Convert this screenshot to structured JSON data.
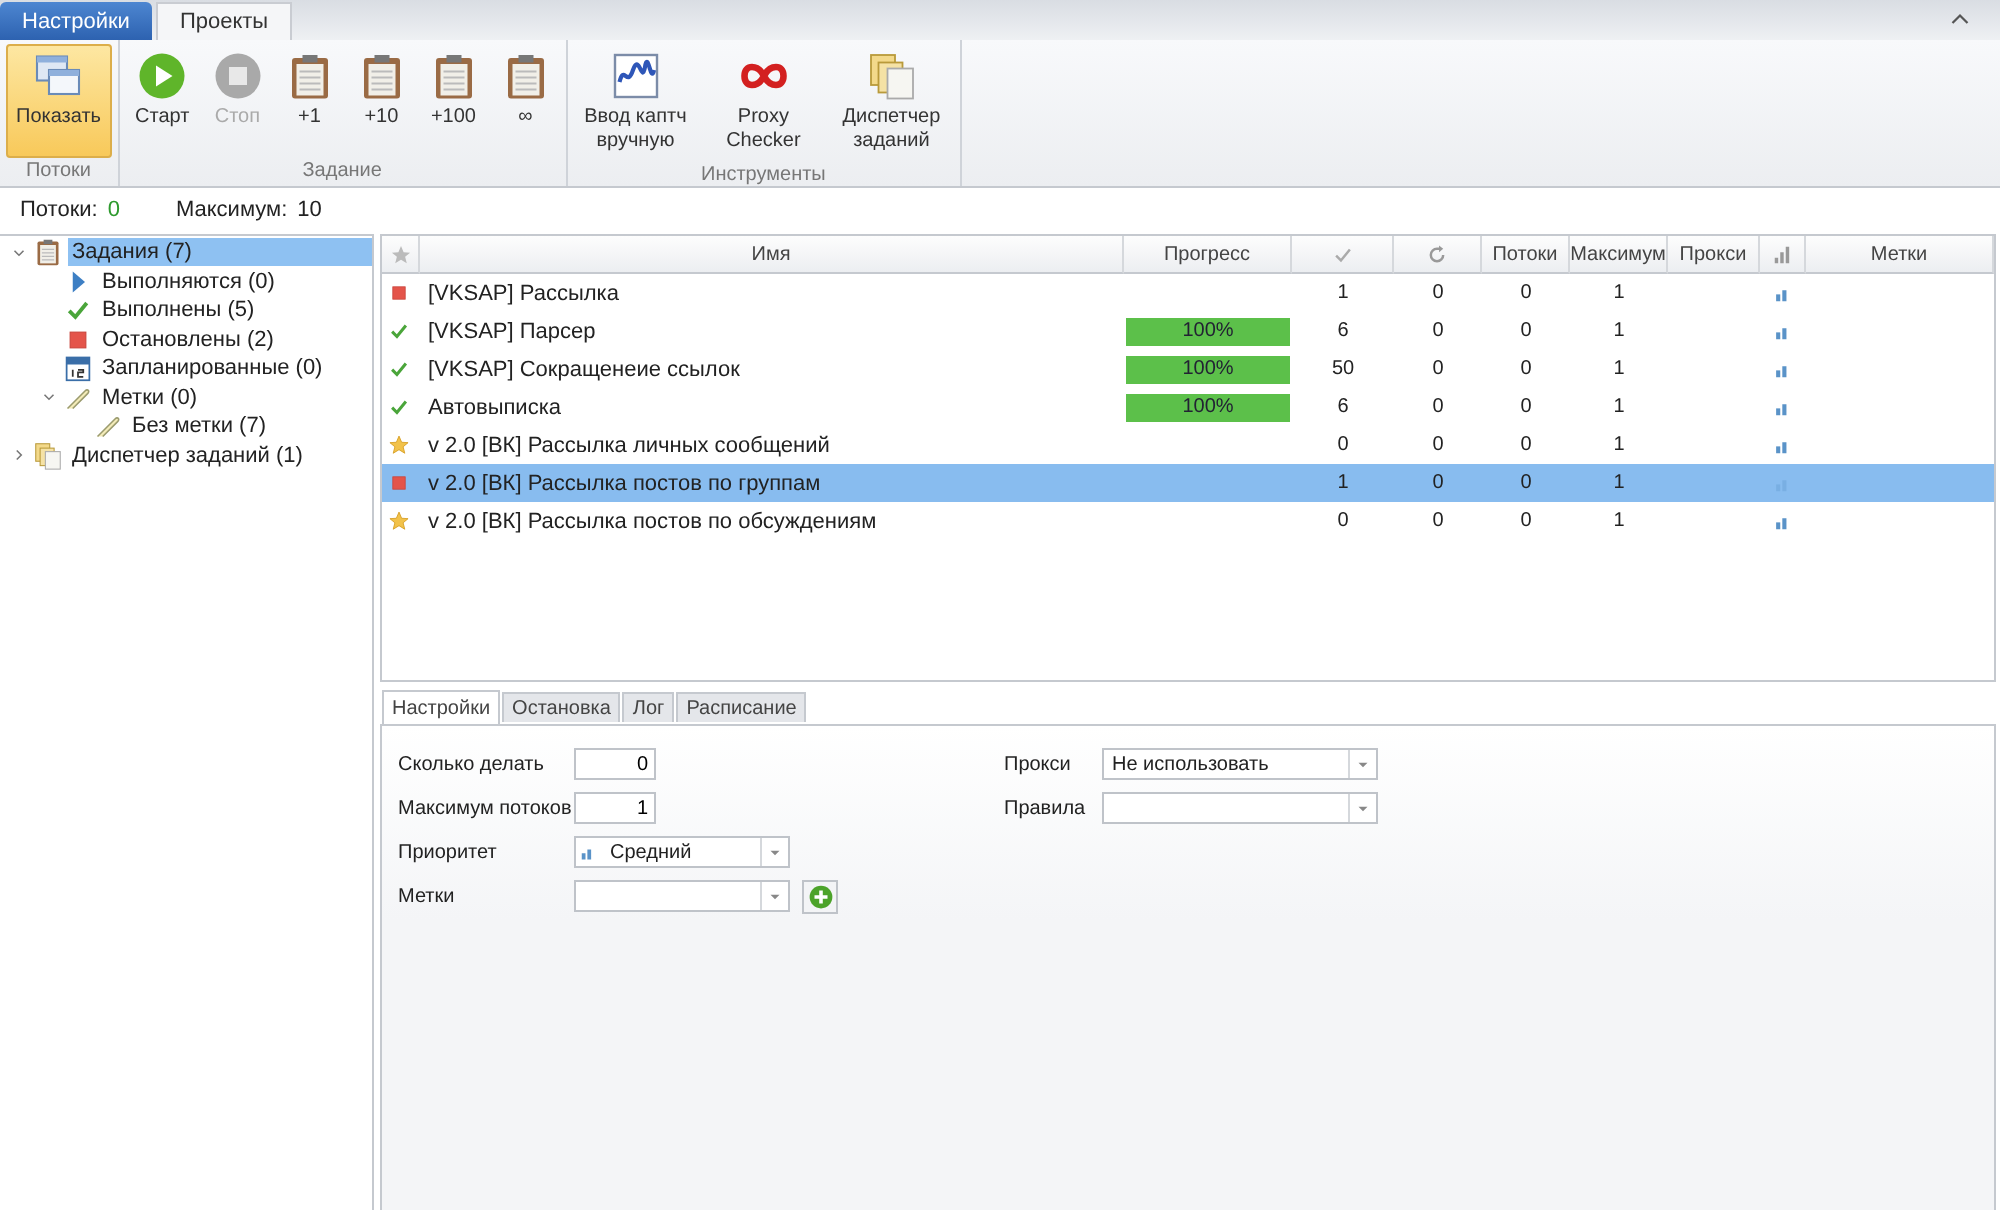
{
  "tabs": [
    {
      "label": "Настройки",
      "kind": "app",
      "selected": false
    },
    {
      "label": "Проекты",
      "kind": "tab",
      "selected": true
    }
  ],
  "ribbon_groups": [
    {
      "label": "Потоки",
      "buttons": [
        {
          "label": "Показать",
          "kind": "windows",
          "pressed": true,
          "disabled": false
        }
      ]
    },
    {
      "label": "Задание",
      "buttons": [
        {
          "label": "Старт",
          "kind": "play",
          "pressed": false,
          "disabled": false
        },
        {
          "label": "Стоп",
          "kind": "stop",
          "pressed": false,
          "disabled": true
        },
        {
          "label": "+1",
          "kind": "clipboard",
          "pressed": false,
          "disabled": false
        },
        {
          "label": "+10",
          "kind": "clipboard",
          "pressed": false,
          "disabled": false
        },
        {
          "label": "+100",
          "kind": "clipboard",
          "pressed": false,
          "disabled": false
        },
        {
          "label": "∞",
          "kind": "clipboard",
          "pressed": false,
          "disabled": false
        }
      ]
    },
    {
      "label": "Инструменты",
      "buttons": [
        {
          "label": "Ввод каптч вручную",
          "kind": "captcha",
          "pressed": false,
          "disabled": false
        },
        {
          "label": "Proxy Checker",
          "kind": "infinity",
          "pressed": false,
          "disabled": false
        },
        {
          "label": "Диспетчер заданий",
          "kind": "documents",
          "pressed": false,
          "disabled": false
        }
      ]
    }
  ],
  "stats": [
    {
      "label": "Потоки:",
      "value": "0",
      "highlight": true
    },
    {
      "label": "Максимум:",
      "value": "10",
      "highlight": false
    }
  ],
  "tree": [
    {
      "label": "Задания (7)",
      "kind": "clipboard",
      "expanded": true,
      "selected": true,
      "children": [
        {
          "label": "Выполняются (0)",
          "kind": "play",
          "selected": false
        },
        {
          "label": "Выполнены (5)",
          "kind": "check",
          "selected": false
        },
        {
          "label": "Остановлены (2)",
          "kind": "stop",
          "selected": false
        },
        {
          "label": "Запланированные (0)",
          "kind": "calendar",
          "selected": false
        },
        {
          "label": "Метки (0)",
          "kind": "pin",
          "expanded": true,
          "selected": false,
          "children": [
            {
              "label": "Без метки (7)",
              "kind": "pin",
              "selected": false
            }
          ]
        }
      ]
    },
    {
      "label": "Диспетчер заданий (1)",
      "kind": "documents",
      "expanded": false,
      "selected": false
    }
  ],
  "table": {
    "columns": [
      {
        "kind": "star"
      },
      {
        "kind": "text",
        "label": "Имя"
      },
      {
        "kind": "text",
        "label": "Прогресс"
      },
      {
        "kind": "check"
      },
      {
        "kind": "refresh"
      },
      {
        "kind": "text",
        "label": "Потоки"
      },
      {
        "kind": "text",
        "label": "Максимум"
      },
      {
        "kind": "text",
        "label": "Прокси"
      },
      {
        "kind": "signal"
      },
      {
        "kind": "text",
        "label": "Метки"
      }
    ],
    "rows": [
      {
        "kind": "stopped",
        "name": "[VKSAP] Рассылка",
        "done": "1",
        "retries": "0",
        "threads": "0",
        "max": "1",
        "selected": false
      },
      {
        "kind": "done",
        "name": "[VKSAP] Парсер",
        "progress": {
          "level": 1,
          "label": "100%"
        },
        "done": "6",
        "retries": "0",
        "threads": "0",
        "max": "1",
        "selected": false
      },
      {
        "kind": "done",
        "name": "[VKSAP] Сокращенеие ссылок",
        "progress": {
          "level": 1,
          "label": "100%"
        },
        "done": "50",
        "retries": "0",
        "threads": "0",
        "max": "1",
        "selected": false
      },
      {
        "kind": "done",
        "name": "Автовыписка",
        "progress": {
          "level": 1,
          "label": "100%"
        },
        "done": "6",
        "retries": "0",
        "threads": "0",
        "max": "1",
        "selected": false
      },
      {
        "kind": "new",
        "name": "v 2.0 [ВК] Рассылка личных сообщений",
        "done": "0",
        "retries": "0",
        "threads": "0",
        "max": "1",
        "selected": false
      },
      {
        "kind": "stopped",
        "name": "v 2.0 [ВК] Рассылка постов по группам",
        "done": "1",
        "retries": "0",
        "threads": "0",
        "max": "1",
        "selected": true
      },
      {
        "kind": "new",
        "name": "v 2.0 [ВК] Рассылка постов по обсуждениям",
        "done": "0",
        "retries": "0",
        "threads": "0",
        "max": "1",
        "selected": false
      }
    ]
  },
  "detail_tabs": [
    {
      "label": "Настройки",
      "selected": true
    },
    {
      "label": "Остановка",
      "selected": false
    },
    {
      "label": "Лог",
      "selected": false
    },
    {
      "label": "Расписание",
      "selected": false
    }
  ],
  "settings": {
    "left": [
      {
        "label": "Сколько делать",
        "kind": "number",
        "value": "0"
      },
      {
        "label": "Максимум потоков",
        "kind": "number",
        "value": "1"
      },
      {
        "label": "Приоритет",
        "kind": "priority",
        "value": "Средний"
      },
      {
        "label": "Метки",
        "kind": "tags"
      }
    ],
    "right": [
      {
        "label": "Прокси",
        "kind": "select",
        "value": "Не использовать"
      },
      {
        "label": "Правила",
        "kind": "select"
      }
    ]
  }
}
